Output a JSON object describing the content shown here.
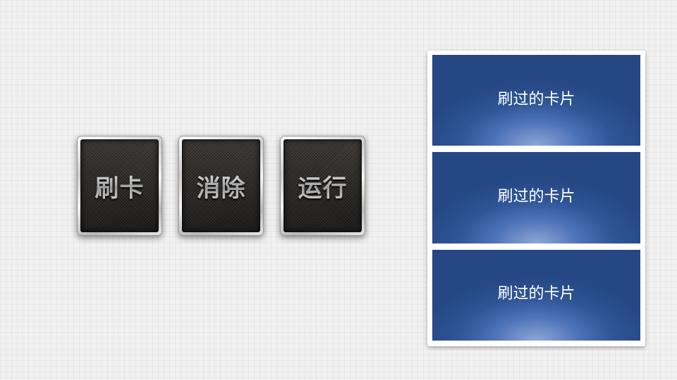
{
  "buttons": {
    "swipe": {
      "label": "刷卡"
    },
    "clear": {
      "label": "消除"
    },
    "run": {
      "label": "运行"
    }
  },
  "cards": [
    {
      "label": "刷过的卡片"
    },
    {
      "label": "刷过的卡片"
    },
    {
      "label": "刷过的卡片"
    }
  ],
  "colors": {
    "background": "#f1f1f1",
    "card_blue": "#2f5597",
    "button_face": "#262626"
  }
}
